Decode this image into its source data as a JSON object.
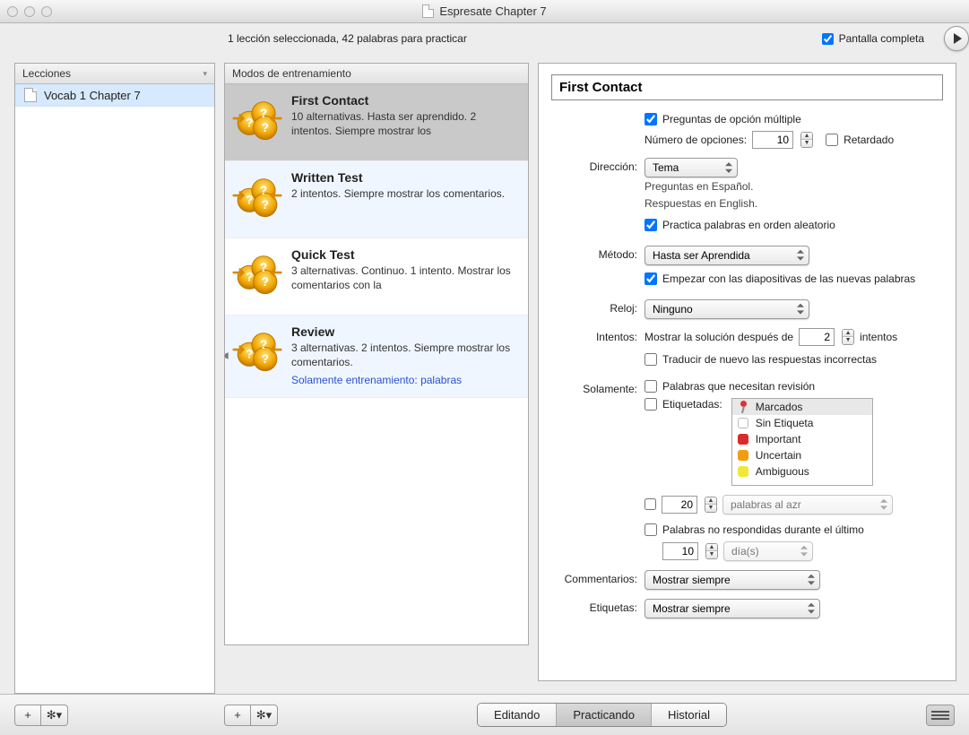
{
  "window": {
    "title": "Espresate Chapter 7"
  },
  "sidebar": {
    "header": "Lecciones",
    "items": [
      {
        "label": "Vocab 1 Chapter 7"
      }
    ]
  },
  "status_text": "1 lección seleccionada, 42 palabras para practicar",
  "fullscreen": {
    "label": "Pantalla completa",
    "checked": true
  },
  "modes": {
    "header": "Modos de entrenamiento",
    "items": [
      {
        "title": "First Contact",
        "desc": "10 alternativas. Hasta ser aprendido. 2 intentos. Siempre mostrar los",
        "selected": true,
        "icon": "first"
      },
      {
        "title": "Written Test",
        "desc": "2 intentos. Siempre mostrar los comentarios.",
        "icon": "written"
      },
      {
        "title": "Quick Test",
        "desc": "3 alternativas. Continuo. 1 intento. Mostrar los comentarios con la",
        "icon": "quick"
      },
      {
        "title": "Review",
        "desc": "3 alternativas. 2 intentos. Siempre mostrar los comentarios.",
        "special": "Solamente entrenamiento: palabras",
        "icon": "review"
      }
    ]
  },
  "details": {
    "title_value": "First Contact",
    "multiple_choice": {
      "label": "Preguntas de opción múltiple",
      "checked": true
    },
    "num_options": {
      "label": "Número de opciones:",
      "value": "10"
    },
    "delayed": {
      "label": "Retardado",
      "checked": false
    },
    "direction": {
      "label": "Dirección:",
      "value": "Tema",
      "sub1": "Preguntas en Español.",
      "sub2": "Respuestas en English."
    },
    "random_order": {
      "label": "Practica palabras en orden aleatorio",
      "checked": true
    },
    "method": {
      "label": "Método:",
      "value": "Hasta ser Aprendida"
    },
    "start_slides": {
      "label": "Empezar con las diapositivas de las nuevas palabras",
      "checked": true
    },
    "clock": {
      "label": "Reloj:",
      "value": "Ninguno"
    },
    "attempts": {
      "label": "Intentos:",
      "prefix": "Mostrar la solución después de",
      "value": "2",
      "suffix": "intentos"
    },
    "retranslate": {
      "label": "Traducir de nuevo las respuestas incorrectas",
      "checked": false
    },
    "only": {
      "label": "Solamente:",
      "needs_review": "Palabras que necesitan revisión"
    },
    "tagged": {
      "label": "Etiquetadas:",
      "checked": false,
      "tags": [
        {
          "label": "Marcados",
          "type": "pin",
          "selected": true
        },
        {
          "label": "Sin Etiqueta",
          "type": "none"
        },
        {
          "label": "Important",
          "color": "#d92b2b"
        },
        {
          "label": "Uncertain",
          "color": "#f39c12"
        },
        {
          "label": "Ambiguous",
          "color": "#f1e73a"
        }
      ]
    },
    "random_n": {
      "value": "20",
      "select": "palabras al azr"
    },
    "not_answered": {
      "label": "Palabras no respondidas durante el último",
      "value": "10",
      "unit": "día(s)"
    },
    "comments": {
      "label": "Commentarios:",
      "value": "Mostrar siempre"
    },
    "labels_row": {
      "label": "Etiquetas:",
      "value": "Mostrar siempre"
    }
  },
  "bottom": {
    "tabs": [
      {
        "label": "Editando"
      },
      {
        "label": "Practicando",
        "active": true
      },
      {
        "label": "Historial"
      }
    ]
  }
}
